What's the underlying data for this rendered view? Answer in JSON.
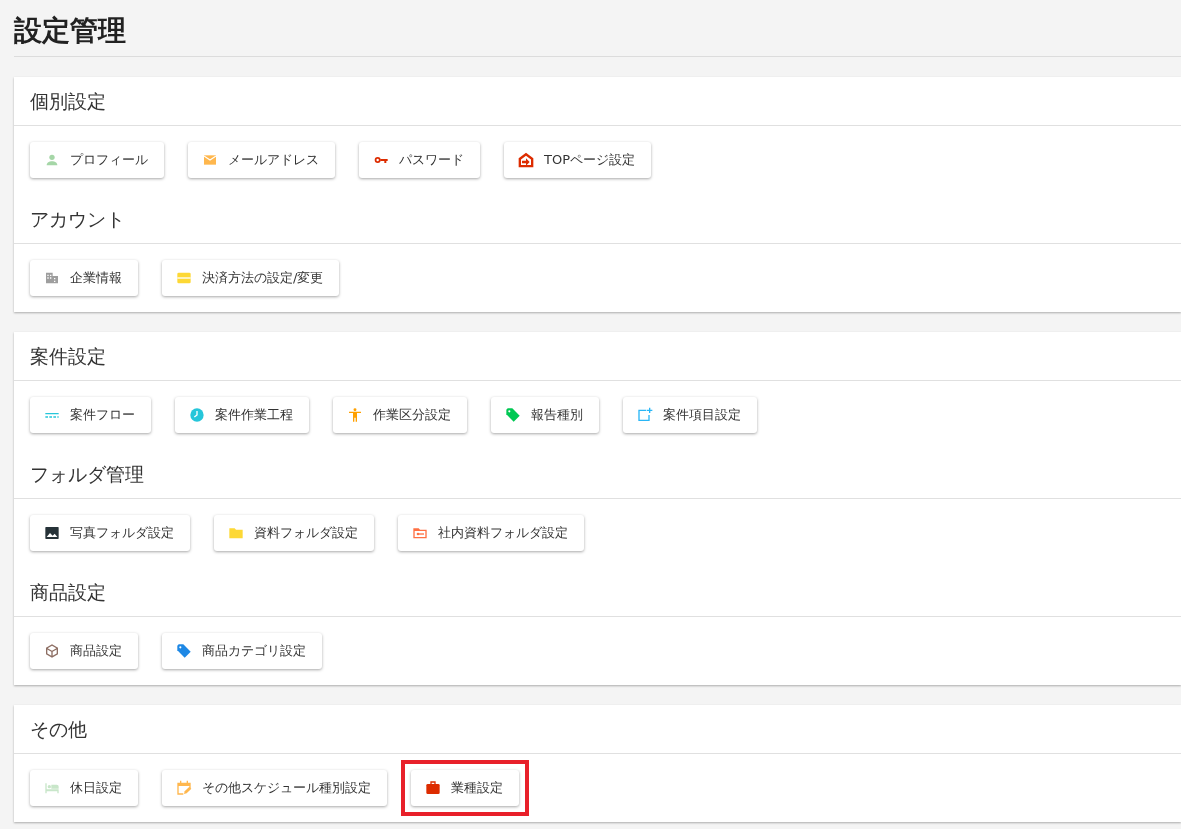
{
  "page_title": "設定管理",
  "cards": [
    {
      "sections": [
        {
          "heading": "個別設定",
          "buttons": [
            {
              "label": "プロフィール",
              "kind": "person",
              "color": "#a5d6a7",
              "highlighted": false
            },
            {
              "label": "メールアドレス",
              "kind": "mail",
              "color": "#ffb74d",
              "highlighted": false
            },
            {
              "label": "パスワード",
              "kind": "key",
              "color": "#dd2c00",
              "highlighted": false
            },
            {
              "label": "TOPページ設定",
              "kind": "home",
              "color": "#dd2c00",
              "highlighted": false
            }
          ]
        },
        {
          "heading": "アカウント",
          "buttons": [
            {
              "label": "企業情報",
              "kind": "building",
              "color": "#9e9e9e",
              "highlighted": false
            },
            {
              "label": "決済方法の設定/変更",
              "kind": "card",
              "color": "#fdd835",
              "highlighted": false
            }
          ]
        }
      ]
    },
    {
      "sections": [
        {
          "heading": "案件設定",
          "buttons": [
            {
              "label": "案件フロー",
              "kind": "flow",
              "color": "#26c6da",
              "highlighted": false
            },
            {
              "label": "案件作業工程",
              "kind": "clock",
              "color": "#26c6da",
              "highlighted": false
            },
            {
              "label": "作業区分設定",
              "kind": "figure",
              "color": "#ffa000",
              "highlighted": false
            },
            {
              "label": "報告種別",
              "kind": "tag",
              "color": "#00c853",
              "highlighted": false
            },
            {
              "label": "案件項目設定",
              "kind": "addbox",
              "color": "#29b6f6",
              "highlighted": false
            }
          ]
        },
        {
          "heading": "フォルダ管理",
          "buttons": [
            {
              "label": "写真フォルダ設定",
              "kind": "image",
              "color": "#263238",
              "highlighted": false
            },
            {
              "label": "資料フォルダ設定",
              "kind": "folder",
              "color": "#fdd835",
              "highlighted": false
            },
            {
              "label": "社内資料フォルダ設定",
              "kind": "keyfolder",
              "color": "#ff7043",
              "highlighted": false
            }
          ]
        },
        {
          "heading": "商品設定",
          "buttons": [
            {
              "label": "商品設定",
              "kind": "cube",
              "color": "#8d6e63",
              "highlighted": false
            },
            {
              "label": "商品カテゴリ設定",
              "kind": "tag",
              "color": "#1e88e5",
              "highlighted": false
            }
          ]
        }
      ]
    },
    {
      "sections": [
        {
          "heading": "その他",
          "buttons": [
            {
              "label": "休日設定",
              "kind": "bed",
              "color": "#c8e6c9",
              "highlighted": false
            },
            {
              "label": "その他スケジュール種別設定",
              "kind": "calendar",
              "color": "#ffb74d",
              "highlighted": false
            },
            {
              "label": "業種設定",
              "kind": "briefcase",
              "color": "#dd2c00",
              "highlighted": true
            }
          ]
        }
      ]
    }
  ]
}
